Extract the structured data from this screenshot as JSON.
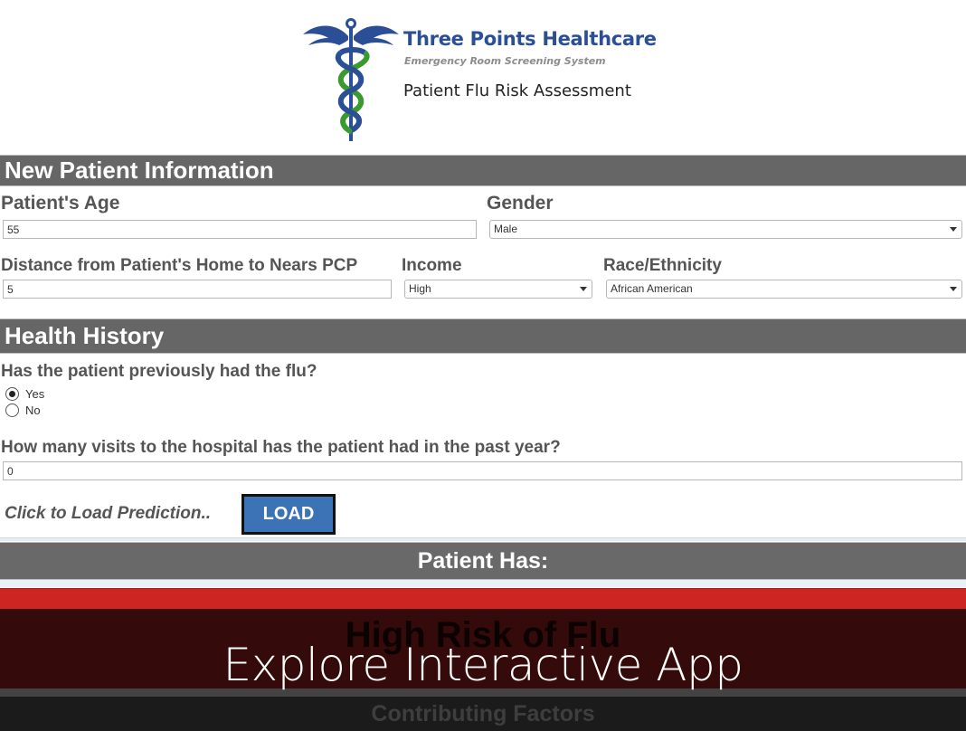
{
  "header": {
    "brand_title": "Three Points Healthcare",
    "brand_subtitle": "Emergency Room Screening System",
    "app_title": "Patient Flu Risk Assessment",
    "logo_icon": "caduceus-icon",
    "colors": {
      "brand_blue": "#2a4f96",
      "logo_green": "#3a9a2e"
    }
  },
  "sections": {
    "new_patient": "New Patient Information",
    "health_history": "Health History"
  },
  "fields": {
    "age": {
      "label": "Patient's Age",
      "value": "55"
    },
    "gender": {
      "label": "Gender",
      "selected": "Male"
    },
    "distance": {
      "label": "Distance from Patient's Home to Nears PCP",
      "value": "5"
    },
    "income": {
      "label": "Income",
      "selected": "High"
    },
    "race": {
      "label": "Race/Ethnicity",
      "selected": "African American"
    },
    "prior_flu": {
      "label": "Has the patient previously had the flu?",
      "options": [
        {
          "label": "Yes",
          "checked": true
        },
        {
          "label": "No",
          "checked": false
        }
      ]
    },
    "visits": {
      "label": "How many visits to the hospital has the patient had in the past year?",
      "value": "0"
    }
  },
  "actions": {
    "load_prompt": "Click to Load Prediction..",
    "load_button": "LOAD",
    "load_button_color": "#3b73b6"
  },
  "result": {
    "header": "Patient Has:",
    "prediction": "High Risk of Flu",
    "risk_color": "#cc2522",
    "factors_header": "Contributing Factors"
  },
  "overlay": {
    "cta": "Explore Interactive App"
  }
}
